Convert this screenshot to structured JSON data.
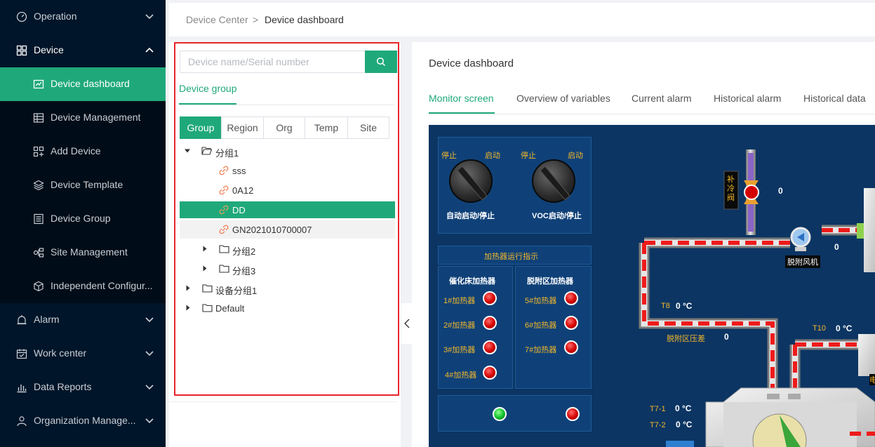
{
  "sidebar": {
    "items": [
      {
        "label": "Operation"
      },
      {
        "label": "Device"
      },
      {
        "label": "Device dashboard"
      },
      {
        "label": "Device Management"
      },
      {
        "label": "Add Device"
      },
      {
        "label": "Device Template"
      },
      {
        "label": "Device Group"
      },
      {
        "label": "Site Management"
      },
      {
        "label": "Independent Configur..."
      },
      {
        "label": "Alarm"
      },
      {
        "label": "Work center"
      },
      {
        "label": "Data Reports"
      },
      {
        "label": "Organization Manage..."
      }
    ]
  },
  "breadcrumb": {
    "parent": "Device Center",
    "separator": ">",
    "current": "Device dashboard"
  },
  "tree": {
    "search_placeholder": "Device name/Serial number",
    "section_title": "Device group",
    "segments": [
      "Group",
      "Region",
      "Org",
      "Temp",
      "Site"
    ],
    "nodes": [
      "分组1",
      "sss",
      "0A12",
      "DD",
      "GN2021010700007",
      "分组2",
      "分组3",
      "设备分组1",
      "Default"
    ]
  },
  "dashboard": {
    "title": "Device dashboard",
    "tabs": [
      "Monitor screen",
      "Overview of variables",
      "Current alarm",
      "Historical alarm",
      "Historical data"
    ],
    "screen": {
      "knob1_stop": "停止",
      "knob1_start": "启动",
      "knob1_label": "自动启动/停止",
      "knob2_stop": "停止",
      "knob2_start": "启动",
      "knob2_label": "VOC启动/停止",
      "heater_title": "加热器运行指示",
      "heater_group1": "催化床加热器",
      "heater_group2": "脱附区加热器",
      "heaters": [
        "1#加热器",
        "2#加热器",
        "3#加热器",
        "4#加热器",
        "5#加热器",
        "6#加热器",
        "7#加热器"
      ],
      "valve_label": "补冷阀",
      "valve_value": "0",
      "fan_label": "脱附风机",
      "fan_value": "0",
      "t8_label": "T8",
      "t8_value": "0 °C",
      "t10_label": "T10",
      "t10_value": "0 °C",
      "pressure_label": "脱附区压差",
      "pressure_value": "0",
      "t71_label": "T7-1",
      "t71_value": "0 °C",
      "t72_label": "T7-2",
      "t72_value": "0 °C",
      "edge_char": "电"
    }
  },
  "colors": {
    "accent": "#1fa97a",
    "sidebar": "#001529",
    "screen": "#0c3563",
    "highlight": "#e8242b"
  }
}
